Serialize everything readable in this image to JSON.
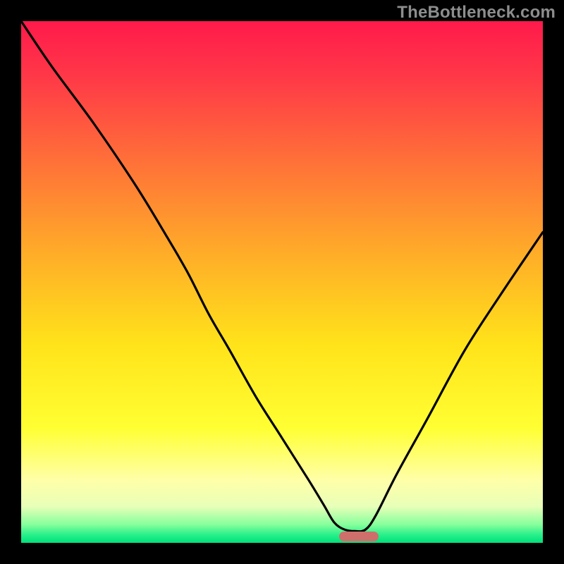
{
  "watermark": {
    "text": "TheBottleneck.com"
  },
  "plot": {
    "gradient_stops": [
      {
        "offset": 0.0,
        "color": "#ff1a4b"
      },
      {
        "offset": 0.1,
        "color": "#ff3648"
      },
      {
        "offset": 0.25,
        "color": "#ff6a3a"
      },
      {
        "offset": 0.45,
        "color": "#ffae28"
      },
      {
        "offset": 0.62,
        "color": "#ffe31a"
      },
      {
        "offset": 0.78,
        "color": "#ffff33"
      },
      {
        "offset": 0.88,
        "color": "#ffffa8"
      },
      {
        "offset": 0.93,
        "color": "#e8ffb8"
      },
      {
        "offset": 0.965,
        "color": "#86ff9c"
      },
      {
        "offset": 0.985,
        "color": "#26f08a"
      },
      {
        "offset": 1.0,
        "color": "#00e07a"
      }
    ],
    "marker": {
      "x_frac": 0.61,
      "width_frac": 0.075,
      "color": "#cf6f6b"
    }
  },
  "chart_data": {
    "type": "line",
    "title": "",
    "xlabel": "",
    "ylabel": "",
    "xlim": [
      0,
      100
    ],
    "ylim": [
      0,
      100
    ],
    "legend": false,
    "grid": false,
    "series": [
      {
        "name": "bottleneck-curve",
        "x": [
          0,
          6,
          14,
          22,
          28,
          32,
          36,
          40,
          45,
          50,
          55,
          58,
          60,
          62,
          64,
          66,
          68,
          72,
          78,
          85,
          92,
          100
        ],
        "values": [
          100,
          91,
          80,
          68,
          58,
          51,
          43,
          36,
          27,
          19,
          11,
          6,
          2.6,
          1.2,
          0.9,
          1.2,
          4,
          12,
          23,
          36,
          47,
          59
        ]
      }
    ],
    "optimal_range": {
      "x_start": 60.5,
      "x_end": 68.0
    }
  }
}
